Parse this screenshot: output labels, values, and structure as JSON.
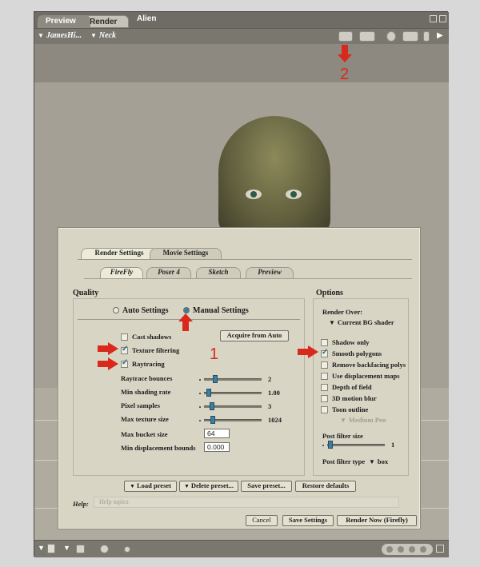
{
  "window": {
    "title": "Alien",
    "tabs": [
      "Preview",
      "Render"
    ],
    "figure_menu": "JamesHi...",
    "body_part_menu": "Neck"
  },
  "annotations": {
    "number_1": "1",
    "number_2": "2",
    "arrow_color": "#d9281c"
  },
  "dialog": {
    "main_tabs": [
      "Render Settings",
      "Movie Settings"
    ],
    "sub_tabs": [
      "FireFly",
      "Poser 4",
      "Sketch",
      "Preview"
    ],
    "quality": {
      "title": "Quality",
      "auto_label": "Auto Settings",
      "manual_label": "Manual Settings",
      "selected": "Manual Settings",
      "cast_shadows": "Cast shadows",
      "texture_filtering": "Texture filtering",
      "raytracing": "Raytracing",
      "acquire_button": "Acquire from Auto",
      "raytrace_bounces": {
        "label": "Raytrace bounces",
        "value": "2",
        "fraction": 0.17
      },
      "min_shading_rate": {
        "label": "Min shading rate",
        "value": "1.00",
        "fraction": 0.05
      },
      "pixel_samples": {
        "label": "Pixel samples",
        "value": "3",
        "fraction": 0.1
      },
      "max_texture_size": {
        "label": "Max texture size",
        "value": "1024",
        "fraction": 0.12
      },
      "max_bucket_size": {
        "label": "Max bucket size",
        "value": "64"
      },
      "min_displacement_bounds": {
        "label": "Min displacement bounds",
        "value": "0.000"
      }
    },
    "options": {
      "title": "Options",
      "render_over_label": "Render Over:",
      "render_over_value": "Current BG shader",
      "shadow_only": "Shadow only",
      "smooth_polygons": "Smooth polygons",
      "remove_backfacing": "Remove backfacing polys",
      "use_displacement": "Use displacement maps",
      "depth_of_field": "Depth of field",
      "motion_blur": "3D motion blur",
      "toon_outline": "Toon outline",
      "toon_style": "Medium Pen",
      "post_filter_size": {
        "label": "Post filter size",
        "value": "1",
        "fraction": 0.02
      },
      "post_filter_type_label": "Post filter type",
      "post_filter_type_value": "box"
    },
    "buttons": {
      "load_preset": "Load preset",
      "delete_preset": "Delete preset...",
      "save_preset": "Save preset...",
      "restore_defaults": "Restore defaults",
      "cancel": "Cancel",
      "save_settings": "Save Settings",
      "render_now": "Render Now (Firefly)"
    },
    "help": {
      "label": "Help:",
      "placeholder": "Help topics"
    }
  }
}
